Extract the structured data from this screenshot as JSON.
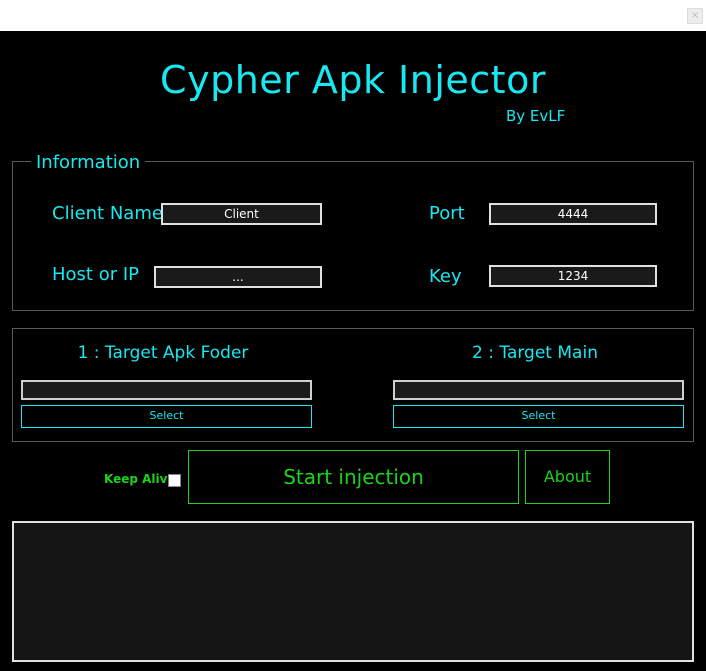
{
  "window": {
    "close_glyph": "×"
  },
  "header": {
    "title": "Cypher Apk Injector",
    "author": "By EvLF"
  },
  "information": {
    "legend": "Information",
    "client_name_label": "Client Name",
    "client_name_value": "Client",
    "port_label": "Port",
    "port_value": "4444",
    "host_label": "Host or IP",
    "host_value": "...",
    "key_label": "Key",
    "key_value": "1234"
  },
  "targets": {
    "apk_folder_label": "1 : Target Apk Foder",
    "apk_folder_value": "",
    "apk_folder_select": "Select",
    "main_label": "2 : Target Main",
    "main_value": "",
    "main_select": "Select"
  },
  "actions": {
    "keep_alive_label": "Keep Alive",
    "keep_alive_checked": false,
    "start_label": "Start injection",
    "about_label": "About"
  },
  "log": {
    "text": ""
  },
  "colors": {
    "accent": "#18e8f0",
    "green": "#19d419",
    "background": "#000000"
  }
}
